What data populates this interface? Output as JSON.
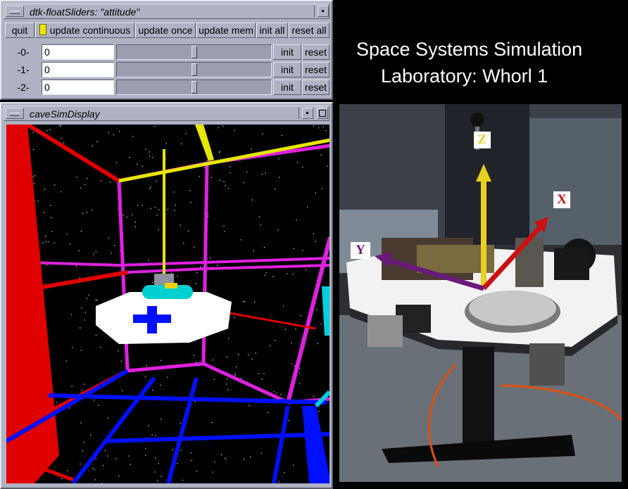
{
  "slider_window": {
    "title": "dtk-floatSliders: \"attitude\"",
    "toolbar": [
      {
        "label": "quit"
      },
      {
        "label": "update continuous",
        "indicator_color": "#f2e600"
      },
      {
        "label": "update once"
      },
      {
        "label": "update mem"
      },
      {
        "label": "init all"
      },
      {
        "label": "reset all"
      }
    ],
    "rows": [
      {
        "label": "-0-",
        "value": "0",
        "slider_fraction": 0.5,
        "init_label": "init",
        "reset_label": "reset"
      },
      {
        "label": "-1-",
        "value": "0",
        "slider_fraction": 0.5,
        "init_label": "init",
        "reset_label": "reset"
      },
      {
        "label": "-2-",
        "value": "0",
        "slider_fraction": 0.5,
        "init_label": "init",
        "reset_label": "reset"
      }
    ]
  },
  "display_window": {
    "title": "caveSimDisplay"
  },
  "headline": {
    "line1": "Space Systems Simulation",
    "line2": "Laboratory: Whorl 1"
  },
  "photo": {
    "axes": [
      {
        "label": "Z",
        "color": "#e8d020"
      },
      {
        "label": "X",
        "color": "#cc1010"
      },
      {
        "label": "Y",
        "color": "#6a1a7a"
      }
    ]
  },
  "colors": {
    "window_bg": "#aeb2c3",
    "cave_red": "#e00000",
    "cave_magenta": "#e020e0",
    "cave_blue": "#0010ff",
    "cave_yellow": "#e6e600",
    "cave_cyan": "#00d0e0"
  }
}
